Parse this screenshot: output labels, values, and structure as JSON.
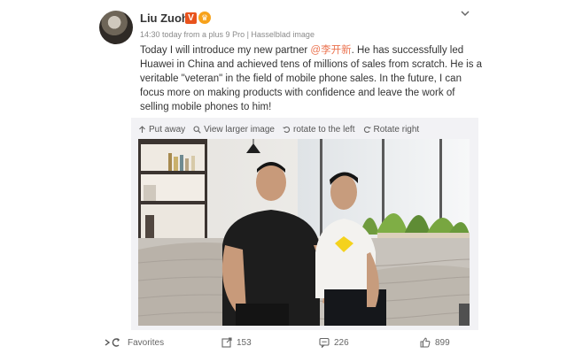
{
  "post": {
    "author": "Liu Zuohu",
    "verified_badge": "V",
    "meta": "14:30 today from a plus 9 Pro | Hasselblad image",
    "text_before_mention": "Today I will introduce my new partner ",
    "mention": "@李开新",
    "text_after_mention": ". He has successfully led Huawei in China and achieved tens of millions of sales from scratch. He is a veritable \"veteran\" in the field of mobile phone sales. In the future, I can focus more on making products with confidence and leave the work of selling mobile phones to him!"
  },
  "media_toolbar": {
    "put_away": "Put away",
    "view_larger": "View larger image",
    "rotate_left": "rotate to the left",
    "rotate_right": "Rotate right"
  },
  "actions": {
    "favorites": "Favorites",
    "reposts": "153",
    "comments": "226",
    "likes": "899"
  },
  "colors": {
    "mention": "#eb7350",
    "verified": "#e8531d",
    "member": "#f7a21b"
  }
}
